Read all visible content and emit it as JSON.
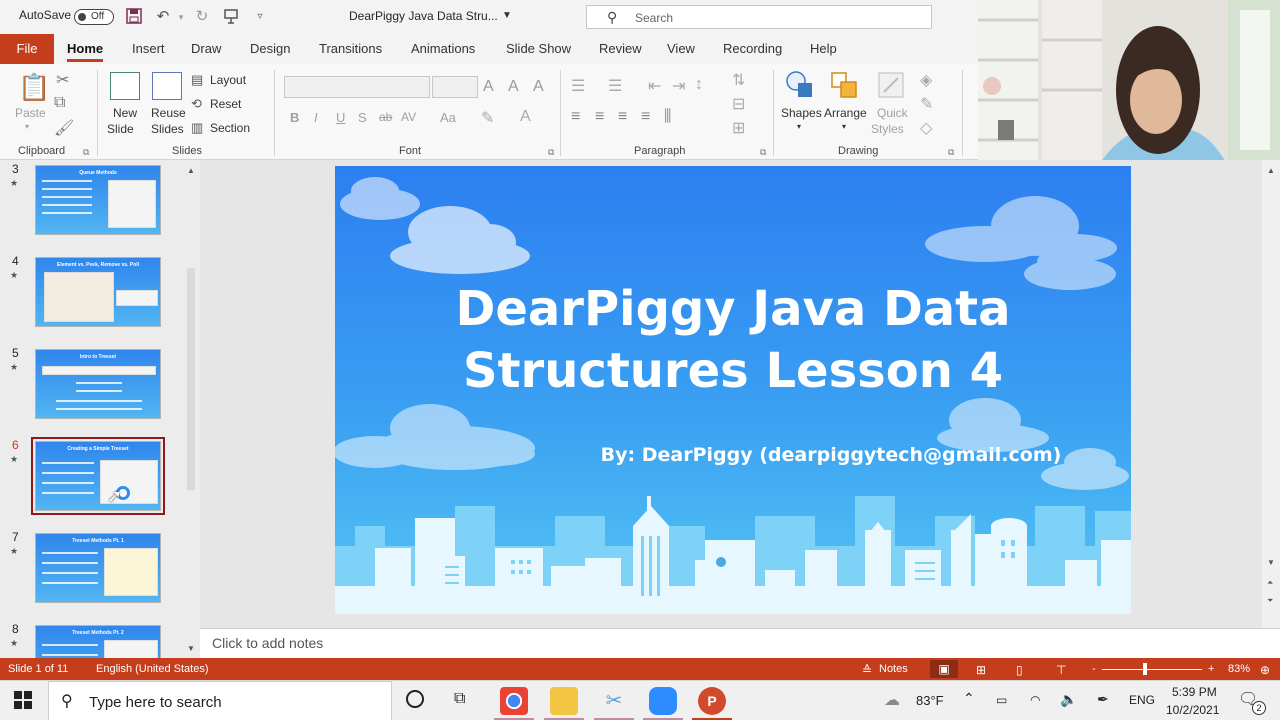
{
  "titlebar": {
    "autosave_label": "AutoSave",
    "autosave_state": "Off",
    "doc_title": "DearPiggy Java Data Stru...",
    "search_placeholder": "Search"
  },
  "ribbon_tabs": [
    "File",
    "Home",
    "Insert",
    "Draw",
    "Design",
    "Transitions",
    "Animations",
    "Slide Show",
    "Review",
    "View",
    "Recording",
    "Help"
  ],
  "active_tab": "Home",
  "ribbon": {
    "clipboard": {
      "paste": "Paste",
      "label": "Clipboard"
    },
    "slides": {
      "new_slide": [
        "New",
        "Slide"
      ],
      "reuse_slides": [
        "Reuse",
        "Slides"
      ],
      "layout": "Layout",
      "reset": "Reset",
      "section": "Section",
      "label": "Slides"
    },
    "font": {
      "label": "Font",
      "bold": "B",
      "italic": "I",
      "underline": "U",
      "strike": "S",
      "strike2": "ab",
      "spacing": "AV",
      "case": "Aa"
    },
    "paragraph": {
      "label": "Paragraph"
    },
    "drawing": {
      "shapes": "Shapes",
      "arrange": "Arrange",
      "quick_styles": [
        "Quick",
        "Styles"
      ],
      "label": "Drawing"
    }
  },
  "thumbnails": [
    {
      "num": "3",
      "title": "Queue Methods",
      "selected": false
    },
    {
      "num": "4",
      "title": "Element vs. Peek, Remove vs. Poll",
      "selected": false
    },
    {
      "num": "5",
      "title": "Intro to Treeset",
      "selected": false
    },
    {
      "num": "6",
      "title": "Creating a Simple Treeset",
      "selected": true
    },
    {
      "num": "7",
      "title": "Treeset Methods Pt. 1",
      "selected": false
    },
    {
      "num": "8",
      "title": "Treeset Methods Pt. 2",
      "selected": false
    }
  ],
  "slide": {
    "title_line1": "DearPiggy Java Data",
    "title_line2": "Structures Lesson 4",
    "subtitle": "By: DearPiggy (dearpiggytech@gmail.com)"
  },
  "notes_placeholder": "Click to add notes",
  "statusbar": {
    "slide_info": "Slide 1 of 11",
    "language": "English (United States)",
    "notes": "Notes",
    "zoom": "83%",
    "zoom_minus": "-",
    "zoom_plus": "+"
  },
  "taskbar": {
    "search_placeholder": "Type here to search",
    "temperature": "83°F",
    "language": "ENG",
    "time": "5:39 PM",
    "date": "10/2/2021",
    "notification_count": "2"
  },
  "colors": {
    "accent": "#c43e1c",
    "slide_top": "#2c7ff0",
    "slide_bottom": "#55c6f4",
    "selected_thumb_border": "#8c1a1a"
  }
}
